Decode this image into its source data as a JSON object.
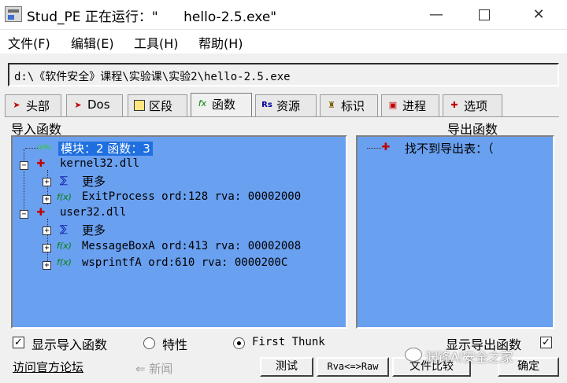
{
  "window": {
    "title": "Stud_PE 正在运行：\"      hello-2.5.exe\"",
    "minimize": "—",
    "close": "✕"
  },
  "menu": [
    "文件(F)",
    "编辑(E)",
    "工具(H)",
    "帮助(H)"
  ],
  "path": "d:\\《软件安全》课程\\实验课\\实验2\\hello-2.5.exe",
  "tabs": [
    {
      "label": "头部",
      "icon": "arrow-icon",
      "active": false
    },
    {
      "label": "Dos",
      "icon": "arrow-icon",
      "active": false
    },
    {
      "label": "区段",
      "icon": "section-icon",
      "active": false
    },
    {
      "label": "函数",
      "icon": "fx-icon",
      "active": true
    },
    {
      "label": "资源",
      "icon": "rs-icon",
      "active": false
    },
    {
      "label": "标识",
      "icon": "id-icon",
      "active": false
    },
    {
      "label": "进程",
      "icon": "process-icon",
      "active": false
    },
    {
      "label": "选项",
      "icon": "options-icon",
      "active": false
    }
  ],
  "imports": {
    "group_label": "导入函数",
    "summary": "模块：2 函数：3",
    "summary_tag": "info",
    "modules": [
      {
        "name": "kernel32.dll",
        "more": "更多",
        "functions": [
          {
            "fx": "f(x)",
            "text": "ExitProcess  ord:128 rva: 00002000"
          }
        ]
      },
      {
        "name": "user32.dll",
        "more": "更多",
        "functions": [
          {
            "fx": "f(x)",
            "text": "MessageBoxA  ord:413 rva: 00002008"
          },
          {
            "fx": "f(x)",
            "text": "wsprintfA  ord:610 rva: 0000200C"
          }
        ]
      }
    ]
  },
  "exports": {
    "group_label": "导出函数",
    "message": "找不到导出表：（"
  },
  "options": {
    "show_imports": "显示导入函数",
    "show_imports_checked": true,
    "characteristics": "特性",
    "first_thunk": "First Thunk",
    "show_exports": "显示导出函数",
    "show_exports_checked": true
  },
  "footer": {
    "forum_link": "访问官方论坛",
    "news": "⇐ 新闻",
    "test_btn": "测试",
    "rva_btn": "Rva<=>Raw",
    "compare_btn": "文件比较",
    "ok_btn": "确定"
  },
  "watermark": "渊锋AI安全之家"
}
